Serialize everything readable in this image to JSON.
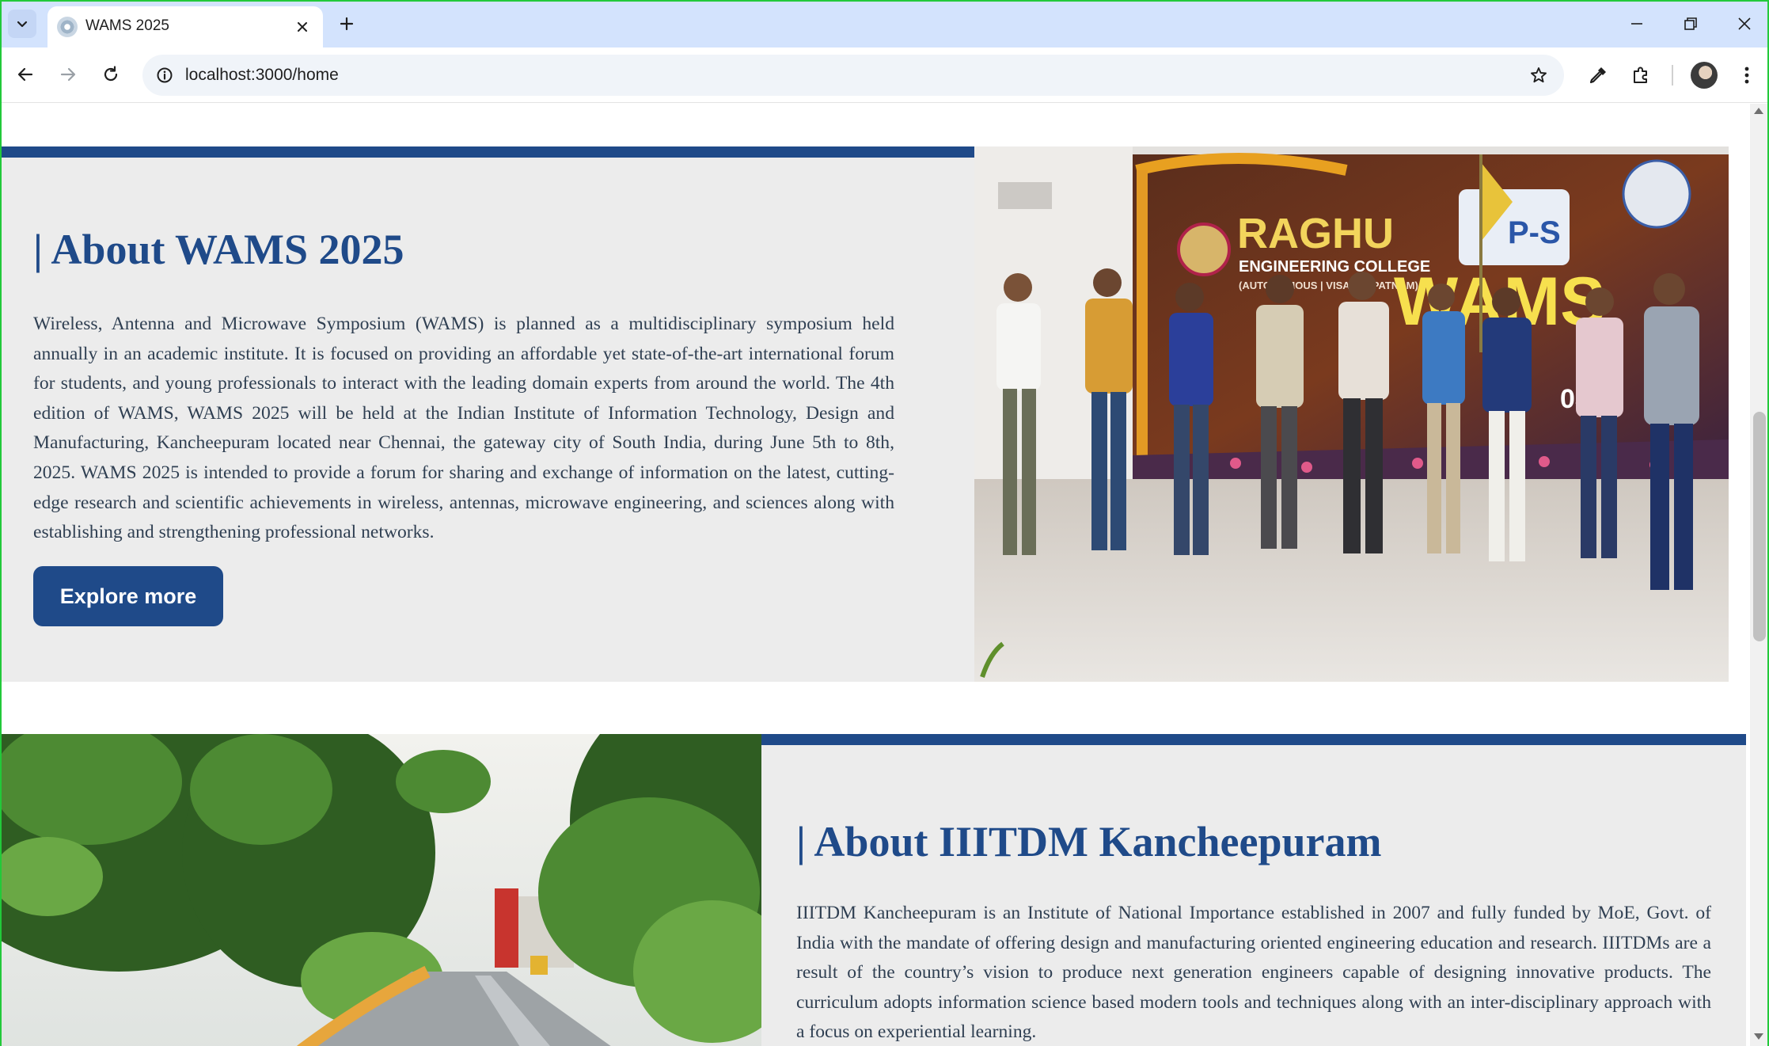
{
  "browser": {
    "tab_title": "WAMS 2025",
    "url": "localhost:3000/home"
  },
  "about_wams": {
    "heading": "| About WAMS 2025",
    "paragraph": "Wireless, Antenna and Microwave Symposium (WAMS) is planned as a multidisciplinary symposium held annually in an academic institute. It is focused on providing an affordable yet state-of-the-art international forum for students, and young professionals to interact with the leading domain experts from around the world. The 4th edition of WAMS, WAMS 2025 will be held at the Indian Institute of Information Technology, Design and Manufacturing, Kancheepuram located near Chennai, the gateway city of South India, during June 5th to 8th, 2025. WAMS 2025 is intended to provide a forum for sharing and exchange of information on the latest, cutting-edge research and scientific achievements in wireless, antennas, microwave engineering, and sciences along with establishing and strengthening professional networks.",
    "button_label": "Explore more",
    "photo": {
      "banner_college": "RAGHU",
      "banner_college_line2": "ENGINEERING COLLEGE",
      "banner_college_line3": "(AUTONOMOUS | VISAKHAPATNAM)",
      "banner_event": "WAMS",
      "banner_society": "P-S",
      "banner_date": "03"
    }
  },
  "about_iiitdm": {
    "heading": "| About IIITDM Kancheepuram",
    "paragraph": "IIITDM Kancheepuram is an Institute of National Importance established in 2007 and fully funded by MoE, Govt. of India with the mandate of offering design and manufacturing oriented engineering education and research. IIITDMs are a result of the country’s vision to produce next generation engineers capable of designing innovative products. The curriculum adopts information science based modern tools and techniques along with an inter-disciplinary approach with a focus on experiential learning."
  },
  "colors": {
    "primary": "#1f4a89",
    "section_bg": "#ececec",
    "tabbar_bg": "#d3e3fd"
  }
}
